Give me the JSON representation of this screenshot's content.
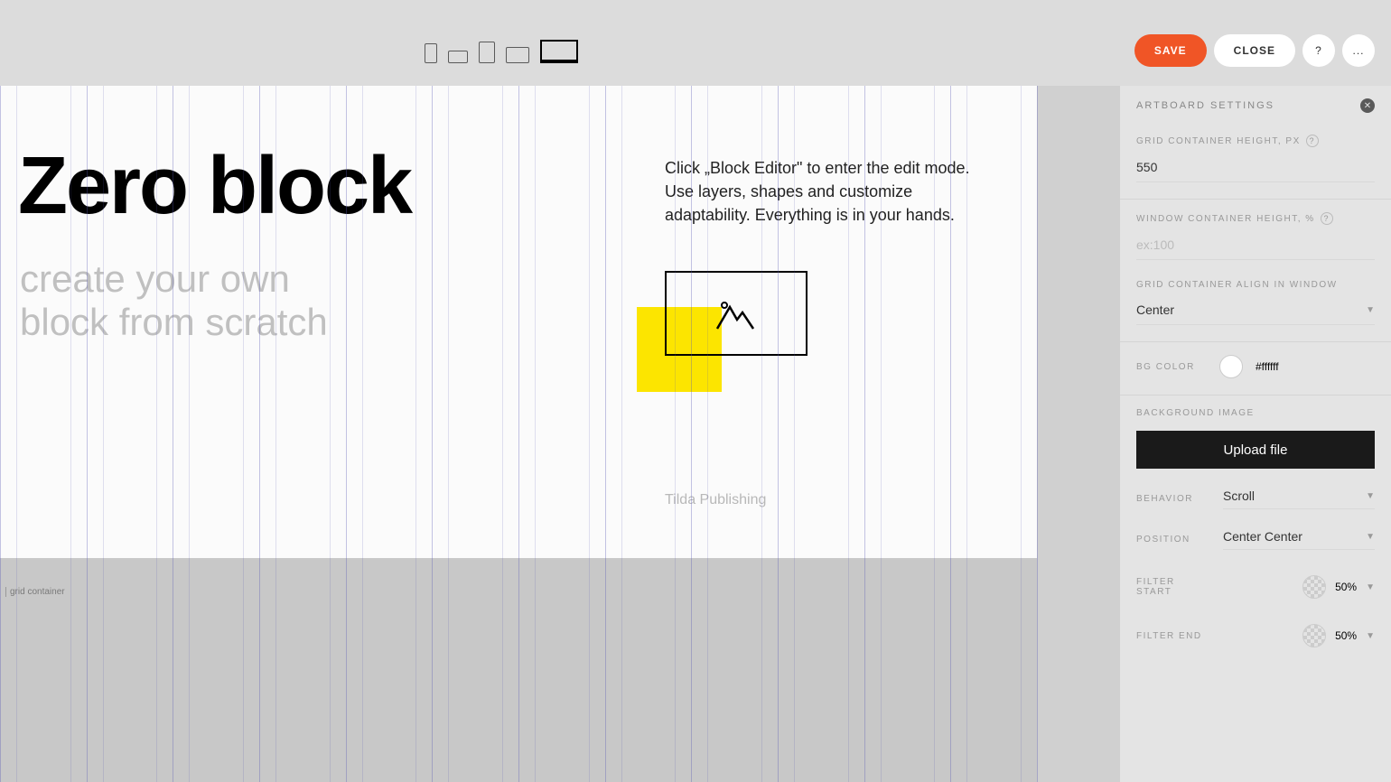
{
  "topbar": {
    "save": "SAVE",
    "close": "CLOSE",
    "help": "?",
    "more": "..."
  },
  "canvas": {
    "heading": "Zero block",
    "subheading": "create your own\nblock from scratch",
    "body": "Click „Block Editor\" to enter the edit mode. Use layers, shapes and customize adaptability. Everything is in your hands.",
    "footer": "Tilda Publishing",
    "grid_container_label": "grid container"
  },
  "panel": {
    "title": "ARTBOARD SETTINGS",
    "grid_height_label": "GRID CONTAINER HEIGHT, PX",
    "grid_height_value": "550",
    "window_height_label": "WINDOW CONTAINER HEIGHT, %",
    "window_height_placeholder": "ex:100",
    "align_label": "GRID CONTAINER ALIGN IN WINDOW",
    "align_value": "Center",
    "bgcolor_label": "BG COLOR",
    "bgcolor_value": "#ffffff",
    "bgimage_label": "BACKGROUND IMAGE",
    "upload_label": "Upload file",
    "behavior_label": "BEHAVIOR",
    "behavior_value": "Scroll",
    "position_label": "POSITION",
    "position_value": "Center Center",
    "filter_start_label": "FILTER START",
    "filter_start_value": "50%",
    "filter_end_label": "FILTER END",
    "filter_end_value": "50%"
  }
}
